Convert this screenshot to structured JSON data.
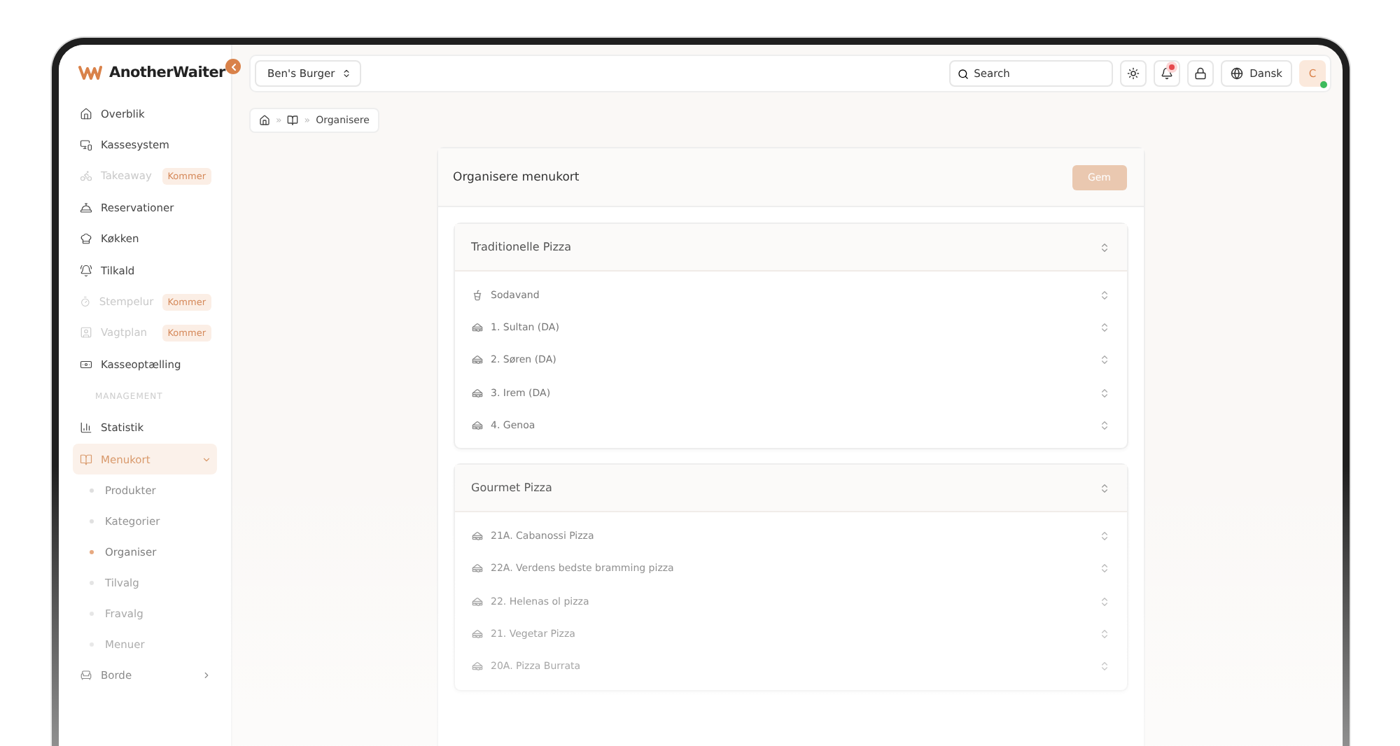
{
  "sidebar": {
    "brand": "AnotherWaiter",
    "items": [
      {
        "kind": "link",
        "label": "Overblik",
        "disabled": false,
        "selected": false
      },
      {
        "kind": "link",
        "label": "Kassesystem",
        "disabled": false,
        "selected": false
      },
      {
        "kind": "link",
        "label": "Takeaway",
        "disabled": true,
        "selected": false,
        "badge": "Kommer"
      },
      {
        "kind": "link",
        "label": "Reservationer",
        "disabled": false,
        "selected": false
      },
      {
        "kind": "link",
        "label": "Køkken",
        "disabled": false,
        "selected": false
      },
      {
        "kind": "link",
        "label": "Tilkald",
        "disabled": false,
        "selected": false
      },
      {
        "kind": "link",
        "label": "Stempelur",
        "disabled": true,
        "selected": false,
        "badge": "Kommer"
      },
      {
        "kind": "link",
        "label": "Vagtplan",
        "disabled": true,
        "selected": false,
        "badge": "Kommer"
      },
      {
        "kind": "link",
        "label": "Kasseoptælling",
        "disabled": false,
        "selected": false
      },
      {
        "kind": "section",
        "label": "MANAGEMENT"
      },
      {
        "kind": "link",
        "label": "Statistik",
        "disabled": false,
        "selected": false
      },
      {
        "kind": "group",
        "label": "Menukort",
        "selected": true,
        "expanded": true,
        "children": [
          {
            "label": "Produkter",
            "selected": false
          },
          {
            "label": "Kategorier",
            "selected": false
          },
          {
            "label": "Organiser",
            "selected": true
          },
          {
            "label": "Tilvalg",
            "selected": false
          },
          {
            "label": "Fravalg",
            "selected": false
          },
          {
            "label": "Menuer",
            "selected": false
          }
        ]
      },
      {
        "kind": "group",
        "label": "Borde",
        "selected": false,
        "expanded": false
      }
    ]
  },
  "topbar": {
    "restaurant": "Ben's Burger",
    "search": {
      "placeholder": "Search"
    },
    "notifications_unread": true,
    "language": "Dansk",
    "avatar": {
      "initial": "C",
      "online": true
    }
  },
  "breadcrumb": {
    "separators": [
      "»",
      "»"
    ],
    "current": "Organisere"
  },
  "card": {
    "title": "Organisere menukort",
    "save_button": {
      "label": "Gem",
      "disabled": true
    },
    "groups": [
      {
        "title": "Traditionelle Pizza",
        "items": [
          {
            "kind": "drink",
            "label": "Sodavand"
          },
          {
            "kind": "food",
            "label": "1. Sultan (DA)"
          },
          {
            "kind": "food",
            "label": "2. Søren (DA)"
          },
          {
            "kind": "food",
            "label": "3. Irem (DA)"
          },
          {
            "kind": "food",
            "label": "4. Genoa"
          }
        ]
      },
      {
        "title": "Gourmet Pizza",
        "items": [
          {
            "kind": "food",
            "label": "21A. Cabanossi Pizza"
          },
          {
            "kind": "food",
            "label": "22A. Verdens bedste bramming pizza"
          },
          {
            "kind": "food",
            "label": "22. Helenas ol pizza"
          },
          {
            "kind": "food",
            "label": "21. Vegetar Pizza"
          },
          {
            "kind": "food",
            "label": "20A. Pizza Burrata"
          }
        ]
      }
    ]
  }
}
